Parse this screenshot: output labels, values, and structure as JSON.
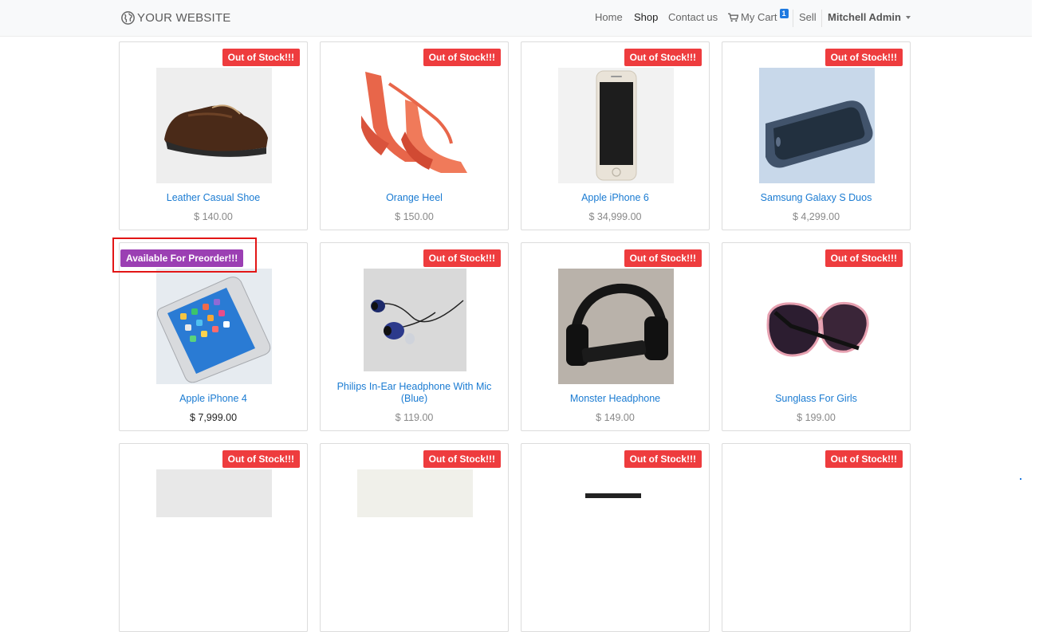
{
  "header": {
    "brand": "YOUR WEBSITE",
    "nav": {
      "home": "Home",
      "shop": "Shop",
      "contact": "Contact us",
      "cart": "My Cart",
      "cart_count": "1",
      "sell": "Sell",
      "user": "Mitchell Admin"
    }
  },
  "ribbons": {
    "out_of_stock": "Out of Stock!!!",
    "preorder": "Available For Preorder!!!"
  },
  "products": [
    {
      "name": "Leather Casual Shoe",
      "price": "$ 140.00",
      "image_icon": "leather-shoe-image",
      "ribbon": "out_of_stock"
    },
    {
      "name": "Orange Heel",
      "price": "$ 150.00",
      "image_icon": "orange-heel-image",
      "ribbon": "out_of_stock"
    },
    {
      "name": "Apple iPhone 6",
      "price": "$ 34,999.00",
      "image_icon": "iphone-image",
      "ribbon": "out_of_stock"
    },
    {
      "name": "Samsung Galaxy S Duos",
      "price": "$ 4,299.00",
      "image_icon": "samsung-phone-image",
      "ribbon": "out_of_stock"
    },
    {
      "name": "Apple iPhone 4",
      "price": "$ 7,999.00",
      "image_icon": "iphone-image",
      "ribbon": "preorder"
    },
    {
      "name": "Philips In-Ear Headphone With Mic (Blue)",
      "price": "$ 119.00",
      "image_icon": "earphones-image",
      "ribbon": "out_of_stock"
    },
    {
      "name": "Monster Headphone",
      "price": "$ 149.00",
      "image_icon": "headphone-image",
      "ribbon": "out_of_stock"
    },
    {
      "name": "Sunglass For Girls",
      "price": "$ 199.00",
      "image_icon": "sunglasses-image",
      "ribbon": "out_of_stock"
    }
  ],
  "colors": {
    "out_of_stock": "#ee3c3e",
    "preorder": "#9b3fb3",
    "link": "#1a7bd2",
    "highlight": "#e21616"
  }
}
